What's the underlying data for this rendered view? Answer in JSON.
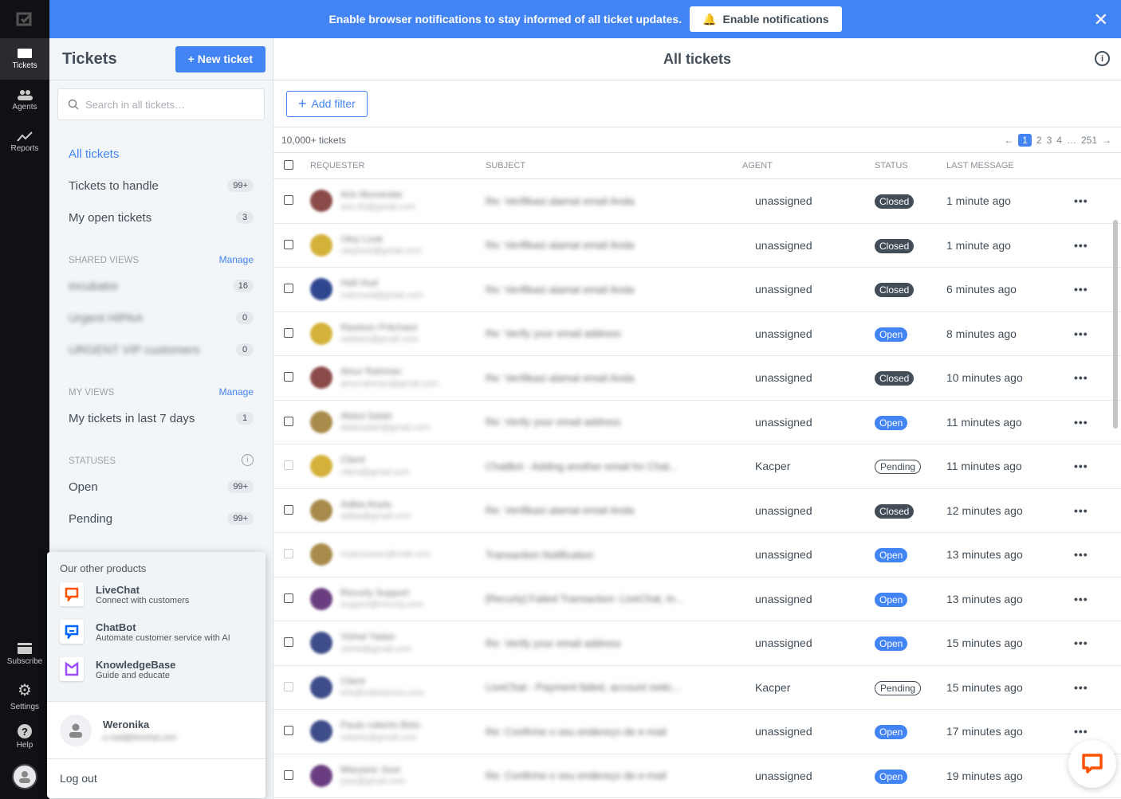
{
  "banner": {
    "message": "Enable browser notifications to stay informed of all ticket updates.",
    "button": "Enable notifications"
  },
  "rail": {
    "items": [
      {
        "label": "Tickets",
        "icon": "ticket-icon"
      },
      {
        "label": "Agents",
        "icon": "agents-icon"
      },
      {
        "label": "Reports",
        "icon": "reports-icon"
      }
    ],
    "bottom": [
      {
        "label": "Subscribe",
        "icon": "card-icon"
      },
      {
        "label": "Settings",
        "icon": "gear-icon"
      },
      {
        "label": "Help",
        "icon": "help-icon"
      }
    ]
  },
  "sidebar": {
    "title": "Tickets",
    "new_ticket": "+ New ticket",
    "search_placeholder": "Search in all tickets…",
    "items": [
      {
        "label": "All tickets",
        "count": ""
      },
      {
        "label": "Tickets to handle",
        "count": "99+"
      },
      {
        "label": "My open tickets",
        "count": "3"
      }
    ],
    "shared_views": {
      "title": "SHARED VIEWS",
      "manage": "Manage",
      "items": [
        {
          "label": "Incubator",
          "count": "16"
        },
        {
          "label": "Urgent HIPAA",
          "count": "0"
        },
        {
          "label": "URGENT VIP customers",
          "count": "0"
        }
      ]
    },
    "my_views": {
      "title": "MY VIEWS",
      "manage": "Manage",
      "items": [
        {
          "label": "My tickets in last 7 days",
          "count": "1"
        }
      ]
    },
    "statuses": {
      "title": "STATUSES",
      "items": [
        {
          "label": "Open",
          "count": "99+"
        },
        {
          "label": "Pending",
          "count": "99+"
        }
      ]
    }
  },
  "main": {
    "title": "All tickets",
    "add_filter": "Add filter",
    "count": "10,000+ tickets",
    "pages": [
      "1",
      "2",
      "3",
      "4",
      "…",
      "251"
    ],
    "columns": [
      "REQUESTER",
      "SUBJECT",
      "AGENT",
      "STATUS",
      "LAST MESSAGE"
    ],
    "rows": [
      {
        "name": "Aris Munandar",
        "email": "aris.92@gmail.com",
        "subject": "Re: Verifikasi alamat email Anda",
        "agent": "unassigned",
        "status": "Closed",
        "last": "1 minute ago",
        "color": "#8a4a48"
      },
      {
        "name": "Uley Look",
        "email": "uleylook@gmail.com",
        "subject": "Re: Verifikasi alamat email Anda",
        "agent": "unassigned",
        "status": "Closed",
        "last": "1 minute ago",
        "color": "#d4b23a"
      },
      {
        "name": "Hafi Hud",
        "email": "mahmud@gmail.com",
        "subject": "Re: Verifikasi alamat email Anda",
        "agent": "unassigned",
        "status": "Closed",
        "last": "6 minutes ago",
        "color": "#2e4690"
      },
      {
        "name": "Raeleen Pritchard",
        "email": "raeleen@gmail.com",
        "subject": "Re: Verify your email address",
        "agent": "unassigned",
        "status": "Open",
        "last": "8 minutes ago",
        "color": "#d4b23a"
      },
      {
        "name": "Ainur Rahman",
        "email": "ainurrahman@gmail.com",
        "subject": "Re: Verifikasi alamat email Anda",
        "agent": "unassigned",
        "status": "Closed",
        "last": "10 minutes ago",
        "color": "#8a4a48"
      },
      {
        "name": "Abdul Salah",
        "email": "abdusalah@gmail.com",
        "subject": "Re: Verify your email address",
        "agent": "unassigned",
        "status": "Open",
        "last": "11 minutes ago",
        "color": "#a88a4a"
      },
      {
        "name": "Client",
        "email": "client@gmail.com",
        "subject": "ChatBot - Adding another email for Chat...",
        "agent": "Kacper",
        "status": "Pending",
        "last": "11 minutes ago",
        "color": "#d4b23a"
      },
      {
        "name": "Adiba Anyla",
        "email": "adiba@gmail.com",
        "subject": "Re: Verifikasi alamat email Anda",
        "agent": "unassigned",
        "status": "Closed",
        "last": "12 minutes ago",
        "color": "#a88a4a"
      },
      {
        "name": "",
        "email": "mybusiness@mail.com",
        "subject": "Transaction Notification",
        "agent": "unassigned",
        "status": "Open",
        "last": "13 minutes ago",
        "color": "#a88a4a"
      },
      {
        "name": "Recurly Support",
        "email": "support@recurly.com",
        "subject": "[Recurly] Failed Transaction: LiveChat, In...",
        "agent": "unassigned",
        "status": "Open",
        "last": "13 minutes ago",
        "color": "#6a3d80"
      },
      {
        "name": "Vishal Yadav",
        "email": "vishal@gmail.com",
        "subject": "Re: Verify your email address",
        "agent": "unassigned",
        "status": "Open",
        "last": "15 minutes ago",
        "color": "#3d4d8a"
      },
      {
        "name": "Client",
        "email": "info@milestones.com",
        "subject": "LiveChat - Payment failed, account switc...",
        "agent": "Kacper",
        "status": "Pending",
        "last": "15 minutes ago",
        "color": "#3d4d8a"
      },
      {
        "name": "Paulo roberto Beto",
        "email": "roberto@gmail.com",
        "subject": "Re: Confirme o seu endereço de e-mail",
        "agent": "unassigned",
        "status": "Open",
        "last": "17 minutes ago",
        "color": "#3d4d8a"
      },
      {
        "name": "Maryane Jose",
        "email": "jose@gmail.com",
        "subject": "Re: Confirme o seu endereço de e-mail",
        "agent": "unassigned",
        "status": "Open",
        "last": "19 minutes ago",
        "color": "#6a3d80"
      }
    ]
  },
  "popup": {
    "title": "Our other products",
    "products": [
      {
        "name": "LiveChat",
        "desc": "Connect with customers",
        "color": "#ff5100"
      },
      {
        "name": "ChatBot",
        "desc": "Automate customer service with AI",
        "color": "#0066ff"
      },
      {
        "name": "KnowledgeBase",
        "desc": "Guide and educate",
        "color": "#9b4dff"
      }
    ],
    "user": {
      "name": "Weronika",
      "email": "e.mail@livechat.com"
    },
    "logout": "Log out"
  }
}
